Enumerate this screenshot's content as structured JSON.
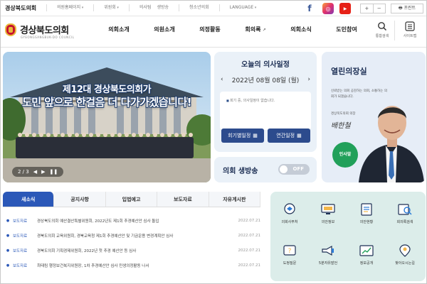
{
  "util": {
    "site_name": "경상북도의회",
    "links": [
      "의원홈페이지",
      "위원회",
      "의사팀",
      "생방송",
      "청소년의회",
      "LANGUAGE"
    ],
    "sns": [
      "f",
      "ig",
      "YouTube"
    ],
    "zoom": {
      "plus": "+",
      "minus": "−"
    },
    "print_label": "프린트"
  },
  "header": {
    "logo_title": "경상북도의회",
    "logo_sub": "GYEONGSANGBUK-DO COUNCIL",
    "nav": [
      "의회소개",
      "의원소개",
      "의정활동",
      "회의록",
      "의회소식",
      "도민참여"
    ],
    "search_label": "통합검색",
    "sitemap_label": "사이트맵"
  },
  "visual": {
    "caption_line1": "제12대 경상북도의회가",
    "caption_line2": "도민 앞으로 한걸음 더 다가가겠습니다!",
    "pager": "2 / 3"
  },
  "schedule": {
    "title": "오늘의 의사일정",
    "date": "2022년 08월 08일 (월)",
    "message": "회기 중, 의사일정이 없습니다.",
    "monthly_button": "회기별일정",
    "yearly_button": "연간일정"
  },
  "live": {
    "label": "의회 생방송",
    "status": "OFF"
  },
  "speaker": {
    "title": "열린의장실",
    "desc": "신뢰받는 의회 공감하는 의회, 소통하는 의회가 되겠습니다.",
    "role": "경상북도의회 의장",
    "signature": "배한철",
    "greet_button": "인사말"
  },
  "news": {
    "tabs": [
      "새소식",
      "공지사항",
      "입법예고",
      "보도자료",
      "자유게시판"
    ],
    "active_tab": 0,
    "rows": [
      {
        "cat": "보도자료",
        "text": "경상북도의회 예산결산특별위원회, 2022년도 제1회 추경예산안 심사 돌입",
        "date": "2022.07.21"
      },
      {
        "cat": "보도자료",
        "text": "경북도의회 교육위원회, 경북교육청 제1회 추경예산안 및 기금운용 변경계획안 심사",
        "date": "2022.07.21"
      },
      {
        "cat": "보도자료",
        "text": "경북도의회 기획경제위원회, 2022년 첫 추경 예산안 등 심사",
        "date": "2022.07.21"
      },
      {
        "cat": "보도자료",
        "text": "최태림 행정보건복지위원장, 1차 추경예산안 심사 민생의정활동 나서",
        "date": "2022.07.21"
      }
    ]
  },
  "quick": {
    "items": [
      "의회사무처",
      "의안정보",
      "의안현황",
      "회의록검색",
      "도정질문",
      "5분자유발언",
      "정보공개",
      "찾아오시는길"
    ]
  },
  "colors": {
    "brand_navy": "#1d2f54",
    "accent_blue": "#2b58b8",
    "button_blue": "#2c4b8d",
    "green": "#21a05a",
    "quick_bg": "#dcedea"
  }
}
